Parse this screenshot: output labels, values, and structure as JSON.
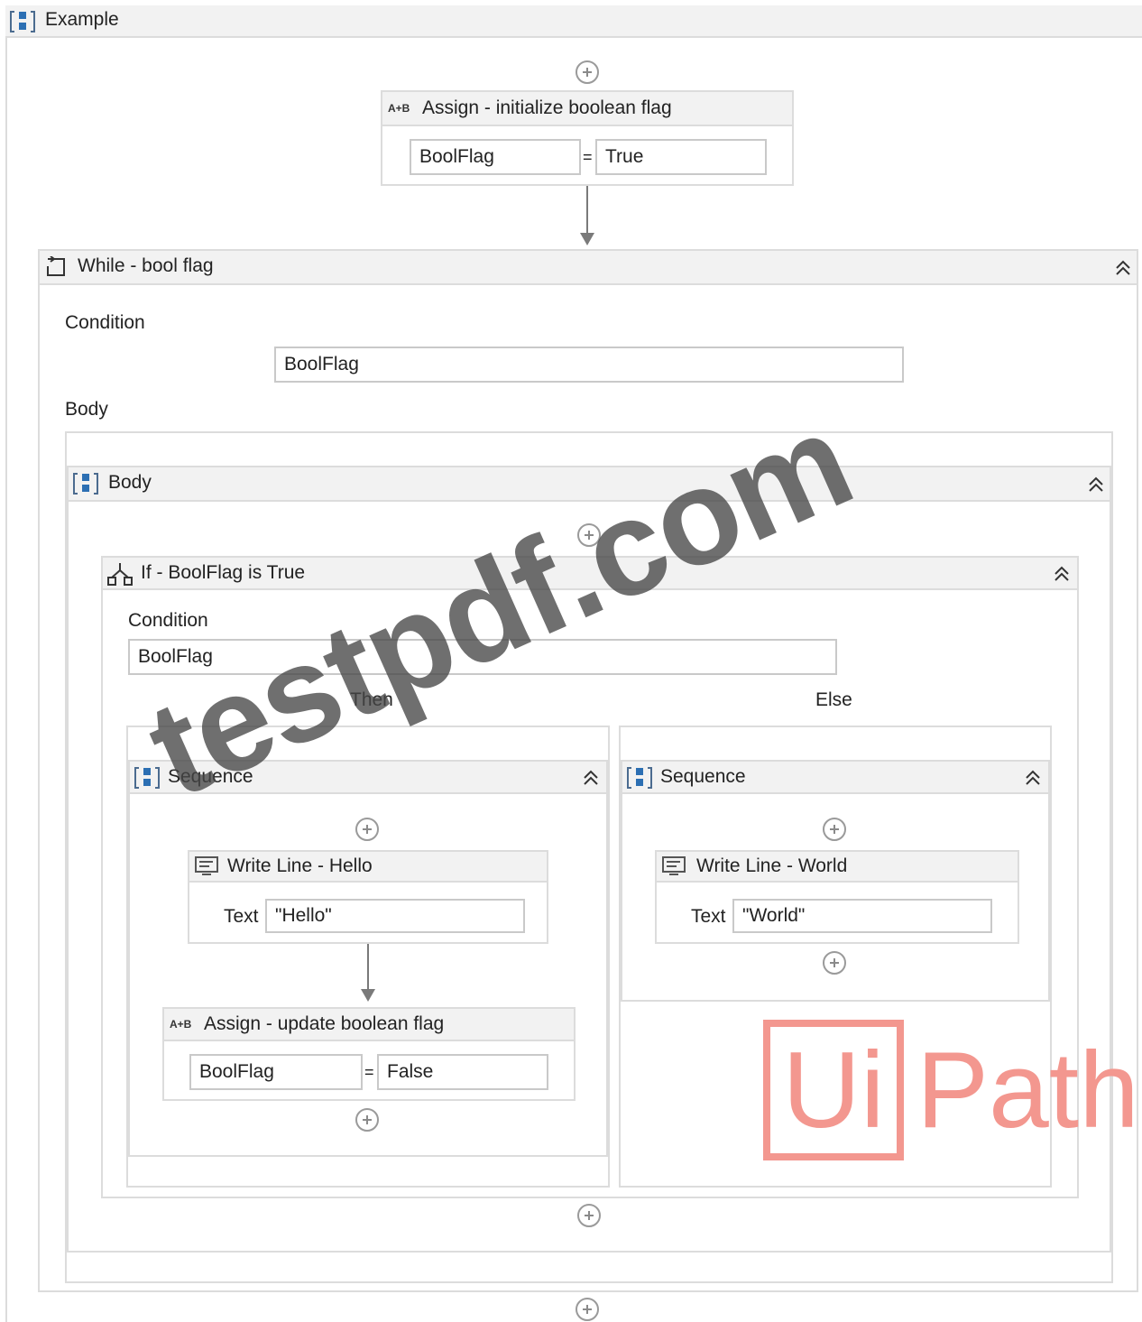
{
  "root": {
    "title": "Example",
    "icon": "sequence-icon"
  },
  "assign_init": {
    "title": "Assign - initialize boolean flag",
    "icon_text": "A+B",
    "to": "BoolFlag",
    "eq": "=",
    "value": "True"
  },
  "while": {
    "title": "While - bool flag",
    "condition_label": "Condition",
    "condition": "BoolFlag",
    "body_label": "Body",
    "body_seq_title": "Body"
  },
  "if": {
    "title": "If - BoolFlag is True",
    "condition_label": "Condition",
    "condition": "BoolFlag",
    "then_label": "Then",
    "else_label": "Else"
  },
  "then_seq": {
    "title": "Sequence",
    "writeline": {
      "title": "Write Line - Hello",
      "text_label": "Text",
      "text": "\"Hello\""
    },
    "assign": {
      "title": "Assign - update boolean flag",
      "icon_text": "A+B",
      "to": "BoolFlag",
      "eq": "=",
      "value": "False"
    }
  },
  "else_seq": {
    "title": "Sequence",
    "writeline": {
      "title": "Write Line - World",
      "text_label": "Text",
      "text": "\"World\""
    }
  },
  "watermark": "testpdf.com",
  "brand": {
    "box": "Ui",
    "rest": "Path",
    "color": "#f3978f"
  }
}
